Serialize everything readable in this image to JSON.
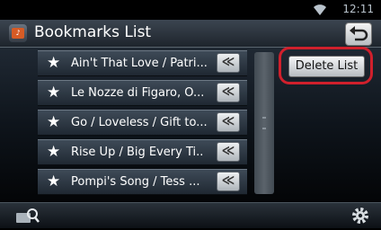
{
  "status": {
    "time": "12:11",
    "wifi_icon": "wifi-icon"
  },
  "header": {
    "title": "Bookmarks List",
    "app_icon": "radio-app-icon",
    "back_icon": "return-icon"
  },
  "bookmarks": [
    {
      "label": "Ain't That Love / Patri...",
      "move": "≪"
    },
    {
      "label": "Le Nozze di Figaro, O...",
      "move": "≪"
    },
    {
      "label": "Go / Loveless / Gift to...",
      "move": "≪"
    },
    {
      "label": "Rise Up / Big Every Ti..",
      "move": "≪"
    },
    {
      "label": "Pompi's Song / Tess ...",
      "move": "≪"
    }
  ],
  "actions": {
    "delete_list": "Delete List"
  },
  "footer": {
    "search_icon": "search-icon",
    "settings_icon": "gear-icon"
  },
  "colors": {
    "highlight": "#d0202c",
    "icon_accent": "#d65b25"
  }
}
